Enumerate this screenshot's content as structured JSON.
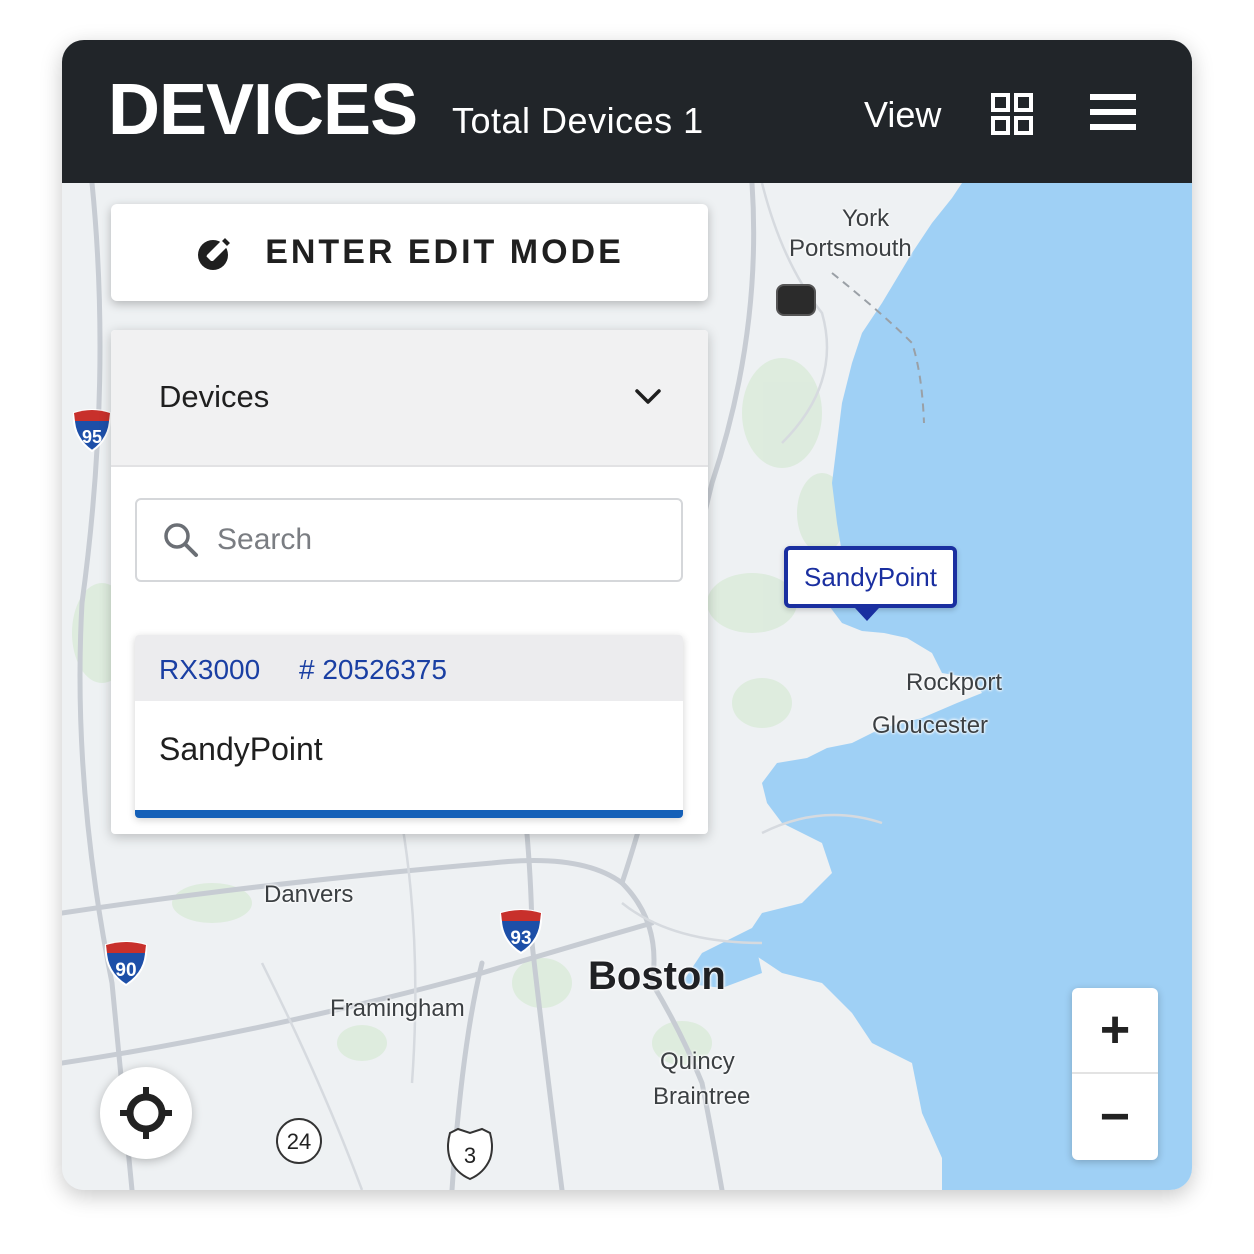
{
  "header": {
    "title": "DEVICES",
    "total_label": "Total Devices 1",
    "view_label": "View",
    "grid_icon": "grid-view-icon",
    "menu_icon": "hamburger-menu-icon"
  },
  "edit_mode": {
    "label": "ENTER EDIT MODE",
    "icon": "edit-mode-icon"
  },
  "devices_panel": {
    "dropdown_label": "Devices",
    "search_placeholder": "Search",
    "search_value": "",
    "devices": [
      {
        "model": "RX3000",
        "serial": "# 20526375",
        "name": "SandyPoint"
      }
    ]
  },
  "map": {
    "marker_label": "SandyPoint",
    "labels": {
      "york": "York",
      "portsmouth": "Portsmouth",
      "rockport": "Rockport",
      "gloucester": "Gloucester",
      "danvers": "Danvers",
      "boston": "Boston",
      "framingham": "Framingham",
      "quincy": "Quincy",
      "braintree": "Braintree"
    },
    "shields": {
      "i95": "95",
      "i93": "93",
      "i90": "90",
      "r24": "24",
      "us3": "3"
    },
    "colors": {
      "water": "#9fd0f5",
      "land": "#eef1f3",
      "accent": "#1a2fa0",
      "header": "#212529"
    }
  },
  "controls": {
    "zoom_in": "+",
    "zoom_out": "−",
    "locate_icon": "my-location-icon"
  }
}
